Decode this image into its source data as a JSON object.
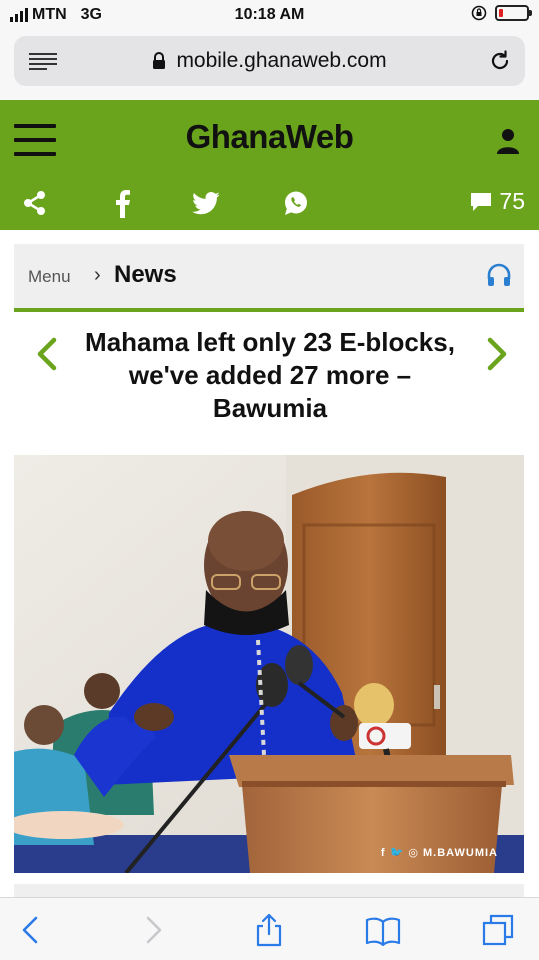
{
  "status_bar": {
    "carrier": "MTN",
    "network": "3G",
    "time": "10:18 AM",
    "battery_percent": 15,
    "icons": [
      "signal-icon",
      "rotation-lock-icon",
      "battery-icon"
    ],
    "battery_color": "#e02020"
  },
  "browser": {
    "url": "mobile.ghanaweb.com",
    "icons": [
      "reader-icon",
      "lock-icon",
      "reload-icon"
    ],
    "toolbar_icons": [
      "back-icon",
      "forward-icon",
      "share-icon",
      "bookmarks-icon",
      "tabs-icon"
    ]
  },
  "header": {
    "logo": "GhanaWeb",
    "brand_color": "#6aa31c",
    "comment_count": "75",
    "social_icons": [
      "share-icon",
      "facebook-icon",
      "twitter-icon",
      "whatsapp-icon"
    ]
  },
  "breadcrumb": {
    "menu_label": "Menu",
    "separator": "›",
    "section": "News",
    "icon": "headphones-icon"
  },
  "article": {
    "headline": "Mahama left only 23 E-blocks, we've added 27 more – Bawumia",
    "image_watermark": "f 🐦 ◎ M.BAWUMIA",
    "accent_color": "#6aa31c"
  }
}
